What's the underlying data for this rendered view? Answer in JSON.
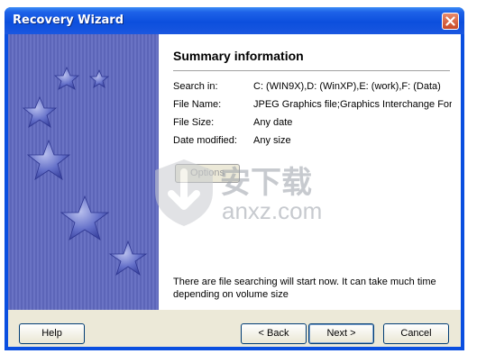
{
  "window": {
    "title": "Recovery Wizard",
    "close_icon": "close-icon"
  },
  "page": {
    "heading": "Summary information"
  },
  "summary": [
    {
      "label": "Search in:",
      "value": "C: (WIN9X),D: (WinXP),E: (work),F: (Data)"
    },
    {
      "label": "File Name:",
      "value": "JPEG Graphics file;Graphics Interchange Format"
    },
    {
      "label": "File Size:",
      "value": "Any date"
    },
    {
      "label": "Date modified:",
      "value": "Any size"
    }
  ],
  "options_button": "Options",
  "status_text": "There are file searching will start now. It can take much time depending on volume size",
  "watermark": {
    "text_cn": "安下载",
    "text_domain": "anxz.com"
  },
  "buttons": {
    "help": "Help",
    "back": "< Back",
    "next": "Next >",
    "cancel": "Cancel"
  },
  "colors": {
    "title_bar": "#0c4fdd",
    "side_panel": "#6a73c4",
    "dialog_face": "#ece9d8"
  }
}
